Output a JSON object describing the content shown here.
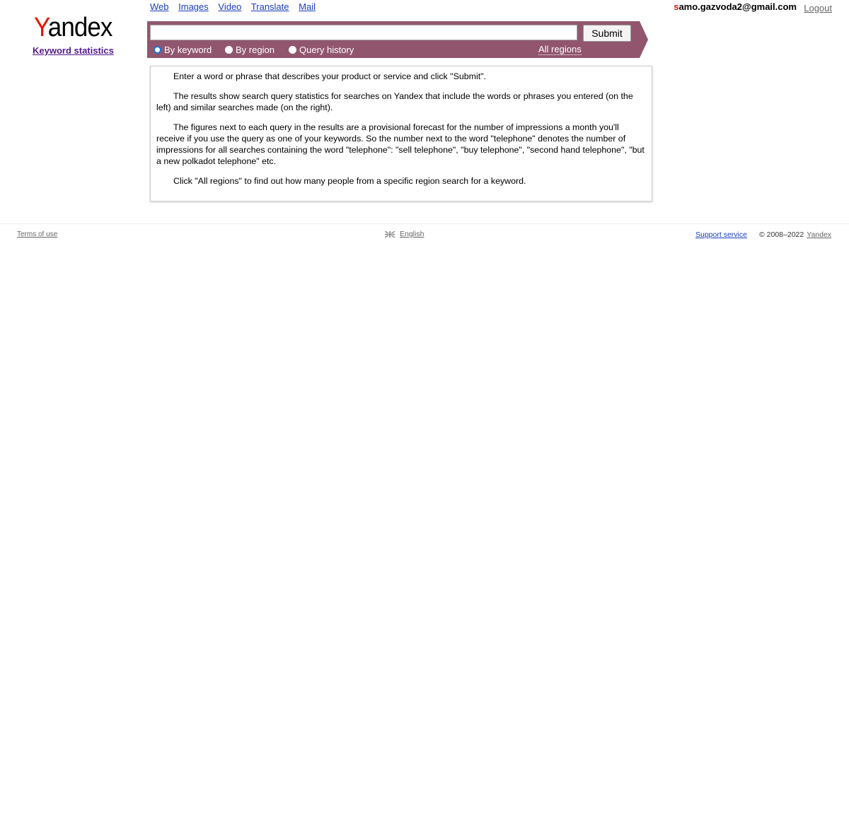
{
  "logo": {
    "first_letter": "Y",
    "rest": "andex"
  },
  "service_link": "Keyword statistics",
  "topnav": [
    "Web",
    "Images",
    "Video",
    "Translate",
    "Mail"
  ],
  "user": {
    "first_char": "s",
    "rest": "amo.gazvoda2@gmail.com"
  },
  "logout": "Logout",
  "search": {
    "value": "",
    "placeholder": "",
    "submit": "Submit"
  },
  "modes": [
    {
      "label": "By keyword",
      "selected": true
    },
    {
      "label": "By region",
      "selected": false
    },
    {
      "label": "Query history",
      "selected": false
    }
  ],
  "regions_link": "All regions",
  "info": {
    "p1": "Enter a word or phrase that describes your product or service and click \"Submit\".",
    "p2": "The results show search query statistics for searches on Yandex that include the words or phrases you entered (on the left) and similar searches made (on the right).",
    "p3": "The figures next to each query in the results are a provisional forecast for the number of impressions a month you'll receive if you use the query as one of your keywords. So the number next to the word \"telephone\" denotes the number of impressions for all searches containing the word \"telephone\": \"sell telephone\", \"buy telephone\", \"second hand telephone\", \"but a new polkadot telephone\" etc.",
    "p4": "Click \"All regions\" to find out how many people from a specific region search for a keyword."
  },
  "footer": {
    "terms": "Terms of use",
    "language": "English",
    "support": "Support service",
    "copyright": "© 2008–2022",
    "copyright_link": "Yandex"
  },
  "colors": {
    "bar": "#91566e",
    "brand_red": "#e61400",
    "link": "#1a3dc1"
  }
}
